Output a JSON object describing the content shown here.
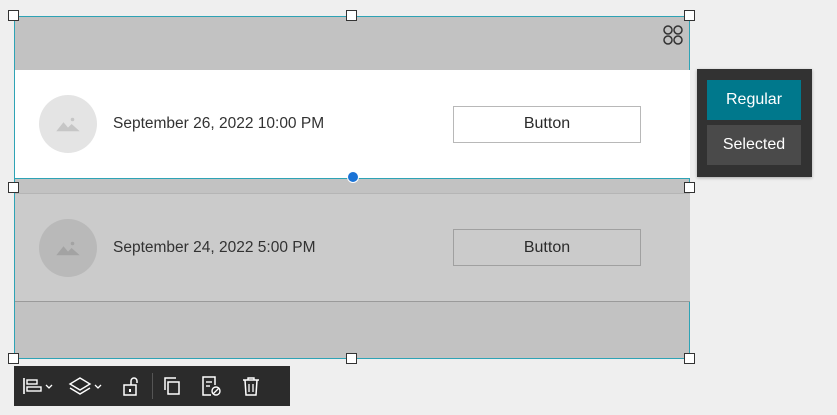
{
  "rows": [
    {
      "date": "September 26, 2022 10:00 PM",
      "button_label": "Button",
      "state": "regular"
    },
    {
      "date": "September 24, 2022 5:00 PM",
      "button_label": "Button",
      "state": "selected"
    }
  ],
  "state_panel": {
    "regular_label": "Regular",
    "selected_label": "Selected",
    "active": "Regular"
  },
  "toolbar": {
    "items": [
      "align-icon",
      "layers-icon",
      "unlock-icon",
      "duplicate-icon",
      "save-template-icon",
      "delete-icon"
    ]
  },
  "colors": {
    "accent": "#00788c",
    "selection_outline": "#2ea3b5",
    "handle_dot": "#1a73d6",
    "toolbar_bg": "#2b2b2b"
  }
}
